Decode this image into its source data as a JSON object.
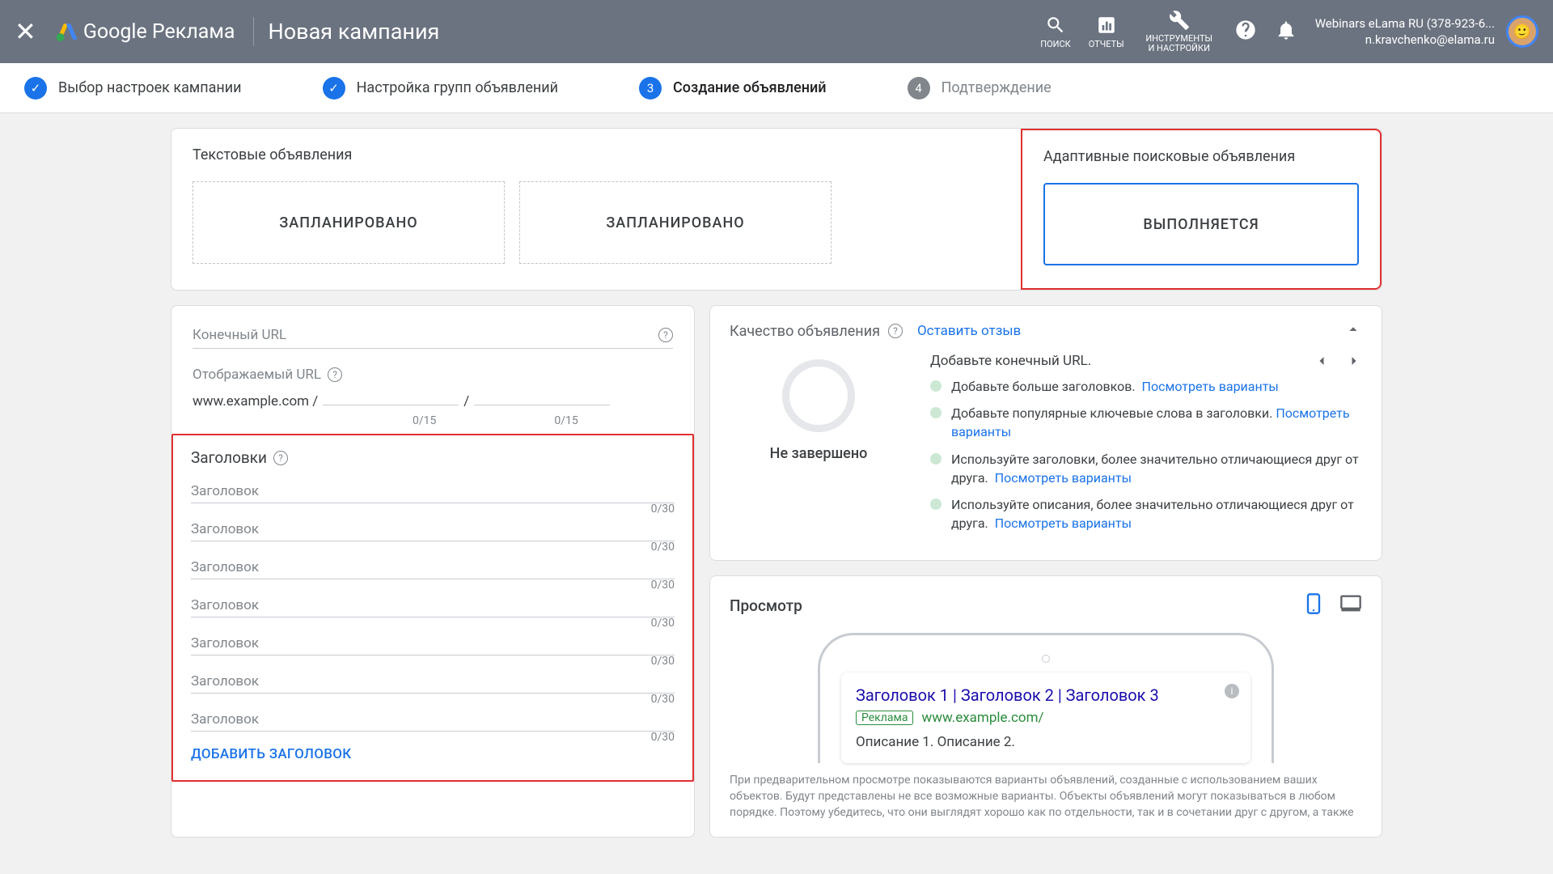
{
  "header": {
    "product": "Google Реклама",
    "page_title": "Новая кампания",
    "tools": {
      "search": "ПОИСК",
      "reports": "ОТЧЕТЫ",
      "settings": "ИНСТРУМЕНТЫ И НАСТРОЙКИ"
    },
    "user": {
      "line1": "Webinars eLama RU (378-923-6...",
      "line2": "n.kravchenko@elama.ru"
    }
  },
  "stepper": [
    {
      "label": "Выбор настроек кампании",
      "state": "done"
    },
    {
      "label": "Настройка групп объявлений",
      "state": "done"
    },
    {
      "label": "Создание объявлений",
      "state": "active",
      "num": "3"
    },
    {
      "label": "Подтверждение",
      "state": "pending",
      "num": "4"
    }
  ],
  "ad_types": {
    "text_title": "Текстовые объявления",
    "planned_label": "ЗАПЛАНИРОВАНО",
    "responsive_title": "Адаптивные поисковые объявления",
    "running_label": "ВЫПОЛНЯЕТСЯ"
  },
  "form": {
    "final_url_label": "Конечный URL",
    "display_url_label": "Отображаемый URL",
    "display_url_base": "www.example.com /",
    "path_counter": "0/15",
    "headlines_title": "Заголовки",
    "headline_placeholder": "Заголовок",
    "headline_counter": "0/30",
    "add_headline": "ДОБАВИТЬ ЗАГОЛОВОК"
  },
  "quality": {
    "title": "Качество объявления",
    "feedback": "Оставить отзыв",
    "tip_header": "Добавьте конечный URL.",
    "status": "Не завершено",
    "tips": [
      {
        "text": "Добавьте больше заголовков.",
        "link": "Посмотреть варианты"
      },
      {
        "text": "Добавьте популярные ключевые слова в заголовки.",
        "link": "Посмотреть варианты"
      },
      {
        "text": "Используйте заголовки, более значительно отличающиеся друг от друга.",
        "link": "Посмотреть варианты"
      },
      {
        "text": "Используйте описания, более значительно отличающиеся друг от друга.",
        "link": "Посмотреть варианты"
      }
    ]
  },
  "preview": {
    "title": "Просмотр",
    "ad_headline": "Заголовок 1 | Заголовок 2 | Заголовок 3",
    "ad_badge": "Реклама",
    "ad_url": "www.example.com/",
    "ad_desc": "Описание 1. Описание 2.",
    "note": "При предварительном просмотре показываются варианты объявлений, созданные с использованием ваших объектов. Будут представлены не все возможные варианты. Объекты объявлений могут показываться в любом порядке. Поэтому убедитесь, что они выглядят хорошо как по отдельности, так и в сочетании друг с другом, а также"
  }
}
